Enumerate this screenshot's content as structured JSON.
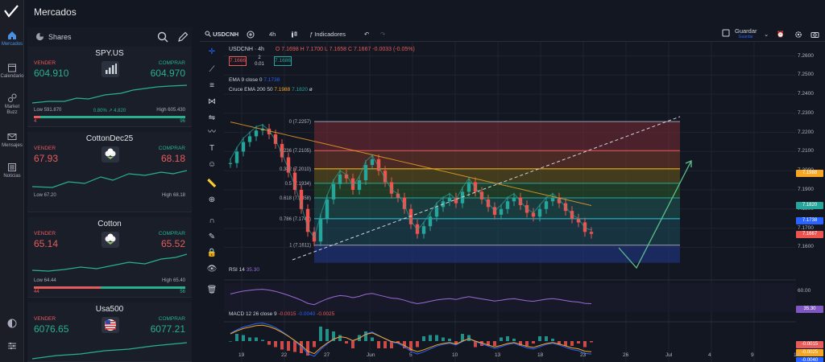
{
  "header": {
    "title": "Mercados"
  },
  "nav": {
    "items": [
      {
        "label": "Mercados",
        "icon": "home-icon",
        "active": true
      },
      {
        "label": "Calendario",
        "icon": "calendar-icon"
      },
      {
        "label": "Market Buzz",
        "icon": "market-buzz-icon"
      },
      {
        "label": "Mensajes",
        "icon": "message-icon"
      },
      {
        "label": "Noticias",
        "icon": "news-icon"
      }
    ]
  },
  "watchlist": {
    "title": "Shares",
    "cards": [
      {
        "name": "SPY.US",
        "sell_label": "VENDER",
        "buy_label": "COMPRAR",
        "sell": "604.910",
        "buy": "604.970",
        "low": "Low 591.870",
        "high": "High 605.430",
        "change": "0.80% ↗ 4.820",
        "left": "4",
        "right": "96",
        "sell_pct": 4,
        "sell_color": "#28b090",
        "icon": "chart-bars-icon"
      },
      {
        "name": "CottonDec25",
        "sell_label": "VENDER",
        "buy_label": "COMPRAR",
        "sell": "67.93",
        "buy": "68.18",
        "low": "Low 67.20",
        "high": "High 68.18",
        "change": "",
        "left": "",
        "right": "",
        "sell_pct": 0,
        "sell_color": "#e85b5b",
        "icon": "cotton-icon"
      },
      {
        "name": "Cotton",
        "sell_label": "VENDER",
        "buy_label": "COMPRAR",
        "sell": "65.14",
        "buy": "65.52",
        "low": "Low 64.44",
        "high": "High 65.40",
        "change": "",
        "left": "44",
        "right": "56",
        "sell_pct": 44,
        "sell_color": "#e85b5b",
        "icon": "cotton-icon"
      },
      {
        "name": "Usa500",
        "sell_label": "VENDER",
        "buy_label": "COMPRAR",
        "sell": "6076.65",
        "buy": "6077.21",
        "low": "",
        "high": "",
        "change": "",
        "left": "",
        "right": "",
        "sell_pct": 0,
        "sell_color": "#28b090",
        "icon": "us-flag-icon"
      }
    ]
  },
  "toolbar": {
    "symbol": "USDCNH",
    "interval": "4h",
    "indicators": "Indicadores",
    "save": "Guardar",
    "save_sub": "Guardar"
  },
  "chart": {
    "legend_title": "USDCNH · 4h",
    "ohlc": "O 7.1698  H 7.1700  L 7.1658  C 7.1667  -0.0033 (-0.05%)",
    "sell_box": "7.1666",
    "spread": "2",
    "spread_sub": "0.01",
    "buy_box": "7.1686",
    "ema_label": "EMA 9 close 0",
    "ema_value": "7.1738",
    "cross_label": "Cruce EMA 200 50",
    "cross_v1": "7.1988",
    "cross_v2": "7.1820",
    "cross_v3": "ø",
    "rsi_label": "RSI 14",
    "rsi_value": "35.30",
    "macd_label": "MACD 12 26 close 9",
    "macd_v1": "-0.0015",
    "macd_v2": "-0.0040",
    "macd_v3": "-0.0025"
  },
  "chart_data": {
    "type": "candlestick",
    "symbol": "USDCNH",
    "interval": "4h",
    "y_ticks": [
      "7.2600",
      "7.2500",
      "7.2400",
      "7.2300",
      "7.2200",
      "7.2100",
      "7.2000",
      "7.1900",
      "7.1800",
      "7.1700",
      "7.1600"
    ],
    "ylim": [
      7.153,
      7.264
    ],
    "x_ticks": [
      "19",
      "22",
      "27",
      "Jun",
      "5",
      "10",
      "13",
      "18",
      "23",
      "26",
      "Jul",
      "4",
      "9",
      "14"
    ],
    "fib_levels": [
      {
        "label": "0 (7.2257)",
        "value": 7.2257
      },
      {
        "label": "0.236 (7.2105)",
        "value": 7.2105
      },
      {
        "label": "0.382 (7.2010)",
        "value": 7.201
      },
      {
        "label": "0.5 (7.1934)",
        "value": 7.1934
      },
      {
        "label": "0.618 (7.1858)",
        "value": 7.1858
      },
      {
        "label": "0.786 (7.1749)",
        "value": 7.1749
      },
      {
        "label": "1 (7.1611)",
        "value": 7.1611
      }
    ],
    "price_tags": [
      {
        "value": "7.1988",
        "color": "#f5a623"
      },
      {
        "value": "7.1820",
        "color": "#26a69a"
      },
      {
        "value": "7.1738",
        "color": "#2962ff"
      },
      {
        "value": "7.1667",
        "color": "#ef5350"
      }
    ],
    "rsi": {
      "value": 35.3,
      "levels": [
        "60.00"
      ]
    },
    "macd": {
      "macd": -0.0015,
      "signal": -0.004,
      "hist": -0.0025
    }
  }
}
